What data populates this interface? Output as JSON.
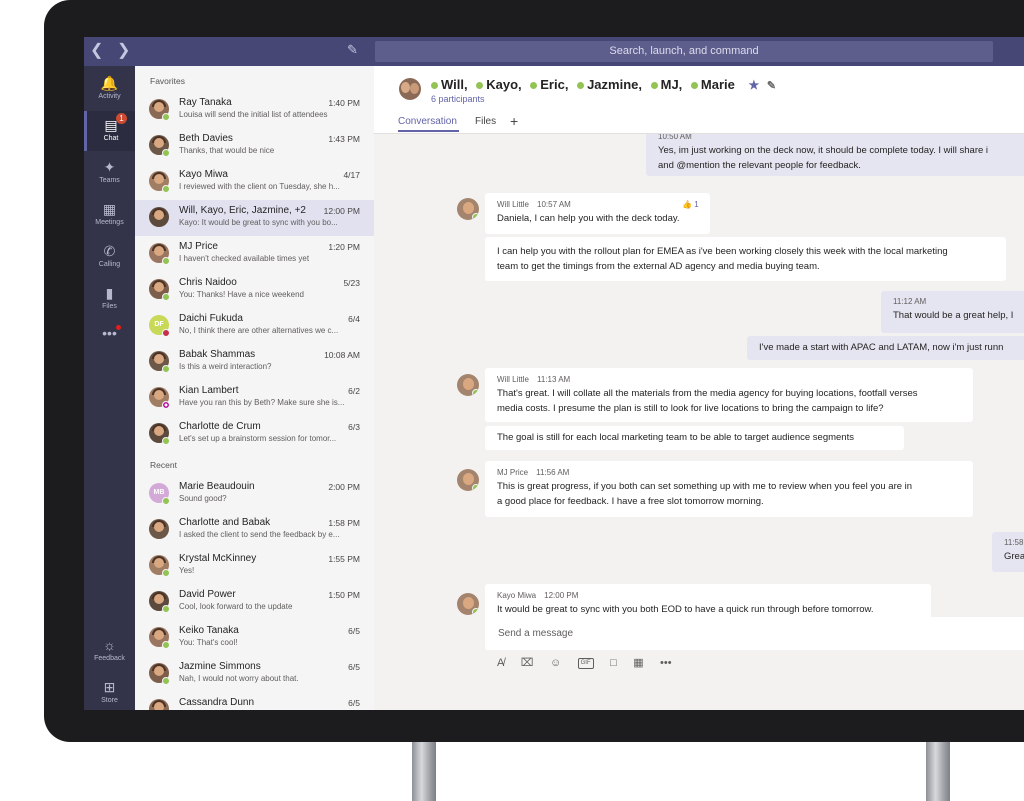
{
  "search": {
    "placeholder": "Search, launch, and command"
  },
  "rail": {
    "items": [
      {
        "label": "Activity",
        "icon": "bell-icon"
      },
      {
        "label": "Chat",
        "icon": "chat-icon",
        "badge": "1"
      },
      {
        "label": "Teams",
        "icon": "teams-icon"
      },
      {
        "label": "Meetings",
        "icon": "calendar-icon"
      },
      {
        "label": "Calling",
        "icon": "phone-icon"
      },
      {
        "label": "Files",
        "icon": "file-icon"
      },
      {
        "label": "",
        "icon": "more-icon"
      }
    ],
    "bottom": [
      {
        "label": "Feedback",
        "icon": "lightbulb-icon"
      },
      {
        "label": "Store",
        "icon": "store-icon"
      }
    ]
  },
  "chat_list": {
    "favorites_label": "Favorites",
    "recent_label": "Recent",
    "favorites": [
      {
        "name": "Ray Tanaka",
        "time": "1:40 PM",
        "preview": "Louisa will send the initial list of attendees",
        "status": "available"
      },
      {
        "name": "Beth Davies",
        "time": "1:43 PM",
        "preview": "Thanks, that would be nice",
        "status": "available"
      },
      {
        "name": "Kayo Miwa",
        "time": "4/17",
        "preview": "I reviewed with the client on Tuesday, she h...",
        "status": "available"
      },
      {
        "name": "Will, Kayo, Eric, Jazmine, +2",
        "time": "12:00 PM",
        "preview": "Kayo: It would be great to sync with you bo...",
        "status": "none"
      },
      {
        "name": "MJ Price",
        "time": "1:20 PM",
        "preview": "I haven't checked available times yet",
        "status": "available"
      },
      {
        "name": "Chris Naidoo",
        "time": "5/23",
        "preview": "You: Thanks! Have a nice weekend",
        "status": "available"
      },
      {
        "name": "Daichi Fukuda",
        "time": "6/4",
        "preview": "No, I think there are other alternatives we c...",
        "status": "busy",
        "initials": "DF"
      },
      {
        "name": "Babak Shammas",
        "time": "10:08 AM",
        "preview": "Is this a weird interaction?",
        "status": "available"
      },
      {
        "name": "Kian Lambert",
        "time": "6/2",
        "preview": "Have you ran this by Beth? Make sure she is...",
        "status": "away"
      },
      {
        "name": "Charlotte de Crum",
        "time": "6/3",
        "preview": "Let's set up a brainstorm session for tomor...",
        "status": "available"
      }
    ],
    "recent": [
      {
        "name": "Marie Beaudouin",
        "time": "2:00 PM",
        "preview": "Sound good?",
        "status": "available",
        "initials": "MB"
      },
      {
        "name": "Charlotte and Babak",
        "time": "1:58 PM",
        "preview": "I asked the client to send the feedback by e...",
        "status": "none"
      },
      {
        "name": "Krystal McKinney",
        "time": "1:55 PM",
        "preview": "Yes!",
        "status": "available"
      },
      {
        "name": "David Power",
        "time": "1:50 PM",
        "preview": "Cool, look forward to the update",
        "status": "available"
      },
      {
        "name": "Keiko Tanaka",
        "time": "6/5",
        "preview": "You: That's cool!",
        "status": "available"
      },
      {
        "name": "Jazmine Simmons",
        "time": "6/5",
        "preview": "Nah, I would not worry about that.",
        "status": "available"
      },
      {
        "name": "Cassandra Dunn",
        "time": "6/5",
        "preview": "",
        "status": "available"
      }
    ]
  },
  "conversation": {
    "participants": [
      "Will,",
      "Kayo,",
      "Eric,",
      "Jazmine,",
      "MJ,",
      "Marie"
    ],
    "participant_count": "6 participants",
    "tabs": [
      "Conversation",
      "Files"
    ],
    "messages": [
      {
        "mine": true,
        "time": "10:50 AM",
        "lines": [
          "Yes, im just working on the deck now, it should be complete today. I will share i",
          "and @mention the relevant people for feedback."
        ]
      },
      {
        "author": "Will Little",
        "time": "10:57 AM",
        "lines": [
          "Daniela, I can help you with the deck today."
        ],
        "likes": "1"
      },
      {
        "author": "",
        "time": "",
        "lines": [
          "I can help you with the rollout plan for EMEA as i've been working closely this week with the local marketing",
          "team to get the timings from the external AD agency and media buying team."
        ]
      },
      {
        "mine": true,
        "time": "11:12 AM",
        "lines": [
          "That would be a great help, I"
        ]
      },
      {
        "mine": true,
        "time": "",
        "lines": [
          "I've made a start with APAC and LATAM, now i'm just runn"
        ]
      },
      {
        "author": "Will Little",
        "time": "11:13 AM",
        "lines": [
          "That's great. I will collate all the materials from the media agency for buying locations, footfall verses",
          "media costs. I presume the plan is still to look for live locations to bring the campaign to life?"
        ]
      },
      {
        "author": "",
        "time": "",
        "lines": [
          "The goal is still for each local marketing team to be able to target audience segments"
        ]
      },
      {
        "author": "MJ Price",
        "time": "11:56 AM",
        "lines": [
          "This is great progress, if you both can set something up with me to review when you feel you are in",
          "a good place for feedback. I have a free slot tomorrow morning."
        ]
      },
      {
        "mine": true,
        "time": "11:58",
        "lines": [
          "Grea"
        ]
      },
      {
        "author": "Kayo Miwa",
        "time": "12:00 PM",
        "lines": [
          "It would be great to sync with you both EOD to have a quick run through before tomorrow."
        ]
      }
    ],
    "compose_placeholder": "Send a message"
  },
  "colors": {
    "accent": "#6264a7",
    "topbar": "#464775",
    "rail": "#33344a",
    "available": "#92c353",
    "busy": "#c4314b"
  }
}
